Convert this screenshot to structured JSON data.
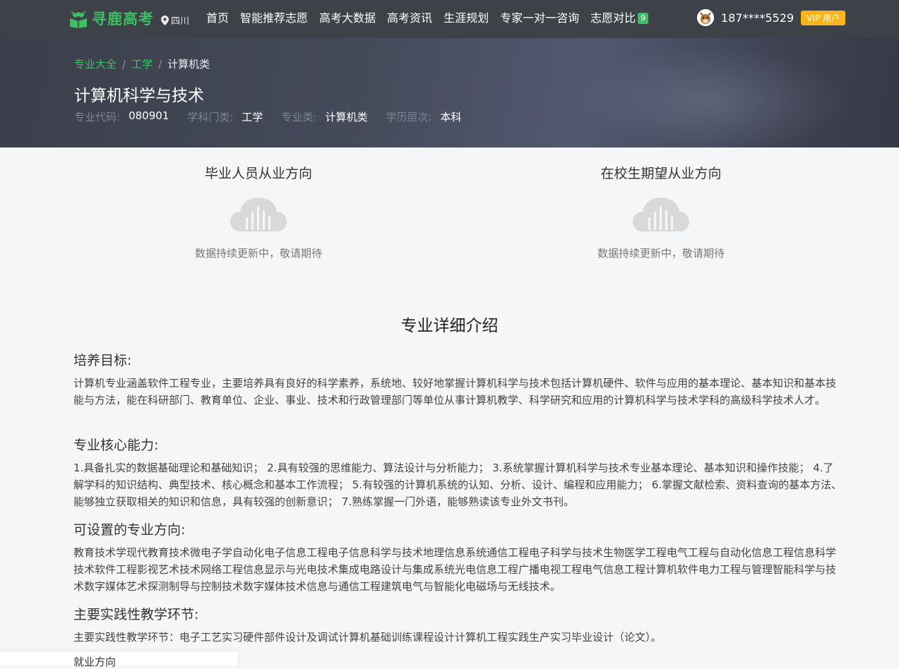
{
  "topbar": {
    "brand": "寻鹿高考",
    "location": "四川",
    "nav": [
      {
        "label": "首页"
      },
      {
        "label": "智能推荐志愿"
      },
      {
        "label": "高考大数据"
      },
      {
        "label": "高考资讯"
      },
      {
        "label": "生涯规划"
      },
      {
        "label": "专家一对一咨询"
      },
      {
        "label": "志愿对比",
        "badge": "9"
      }
    ],
    "phone": "187****5529",
    "vip_label": "VIP 用户"
  },
  "breadcrumb": [
    "专业大全",
    "工学",
    "计算机类"
  ],
  "major": {
    "title": "计算机科学与技术",
    "code_label": "专业代码:",
    "code": "080901",
    "category_label": "学科门类:",
    "category": "工学",
    "class_label": "专业类:",
    "class": "计算机类",
    "level_label": "学历层次:",
    "level": "本科"
  },
  "stats": {
    "graduates_title": "毕业人员从业方向",
    "students_title": "在校生期望从业方向",
    "empty_text": "数据持续更新中，敬请期待"
  },
  "intro": {
    "title": "专业详细介绍",
    "sections": [
      {
        "heading": "培养目标:",
        "text": "计算机专业涵盖软件工程专业，主要培养具有良好的科学素养，系统地、较好地掌握计算机科学与技术包括计算机硬件、软件与应用的基本理论、基本知识和基本技能与方法，能在科研部门、教育单位、企业、事业、技术和行政管理部门等单位从事计算机教学、科学研究和应用的计算机科学与技术学科的高级科学技术人才。"
      },
      {
        "heading": "专业核心能力:",
        "text": "1.具备扎实的数据基础理论和基础知识；  2.具有较强的思维能力、算法设计与分析能力；  3.系统掌握计算机科学与技术专业基本理论、基本知识和操作技能；  4.了解学科的知识结构、典型技术、核心概念和基本工作流程；  5.有较强的计算机系统的认知、分析、设计、编程和应用能力；  6.掌握文献检索、资料查询的基本方法、能够独立获取相关的知识和信息，具有较强的创新意识；  7.熟练掌握一门外语，能够熟读该专业外文书刊。"
      },
      {
        "heading": "可设置的专业方向:",
        "text": "教育技术学现代教育技术微电子学自动化电子信息工程电子信息科学与技术地理信息系统通信工程电子科学与技术生物医学工程电气工程与自动化信息工程信息科学技术软件工程影视艺术技术网络工程信息显示与光电技术集成电路设计与集成系统光电信息工程广播电视工程电气信息工程计算机软件电力工程与管理智能科学与技术数字媒体艺术探测制导与控制技术数字媒体技术信息与通信工程建筑电气与智能化电磁场与无线技术。"
      },
      {
        "heading": "主要实践性教学环节:",
        "text": "主要实践性教学环节：电子工艺实习硬件部件设计及调试计算机基础训练课程设计计算机工程实践生产实习毕业设计（论文）。"
      }
    ]
  },
  "bottom_tab": "就业方向",
  "colors": {
    "brand_green": "#3dbf63",
    "nav_bg": "#3d4148",
    "vip": "#f9b31b"
  }
}
